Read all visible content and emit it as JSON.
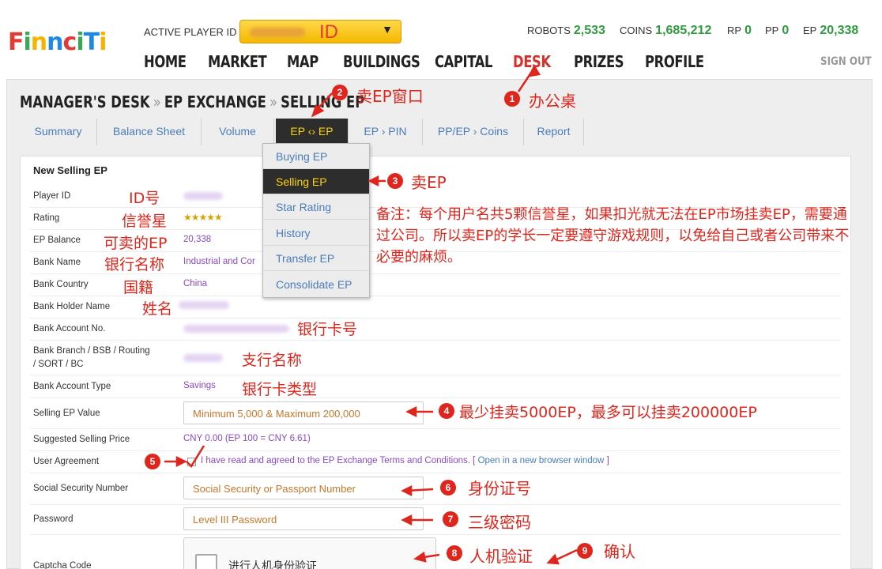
{
  "header": {
    "logo_letters": [
      "F",
      "i",
      "n",
      "n",
      "c",
      "i",
      "T",
      "i"
    ],
    "logo_colors": [
      "#e53935",
      "#3aa757",
      "#f4b400",
      "#1e88e5",
      "#e53935",
      "#3aa757",
      "#1e88e5",
      "#f4b400"
    ],
    "active_player_label": "ACTIVE PLAYER ID",
    "player_select_value": "ID",
    "stats": [
      {
        "label": "ROBOTS",
        "value": "2,533"
      },
      {
        "label": "COINS",
        "value": "1,685,212"
      },
      {
        "label": "RP",
        "value": "0"
      },
      {
        "label": "PP",
        "value": "0"
      },
      {
        "label": "EP",
        "value": "20,338"
      }
    ],
    "nav": [
      "HOME",
      "MARKET",
      "MAP",
      "BUILDINGS",
      "CAPITAL",
      "DESK",
      "PRIZES",
      "PROFILE"
    ],
    "active_nav": "DESK",
    "sign_out": "SIGN OUT"
  },
  "breadcrumb": [
    "MANAGER'S DESK",
    "EP EXCHANGE",
    "SELLING EP"
  ],
  "breadcrumb_separator": "»",
  "tabs": [
    "Summary",
    "Balance Sheet",
    "Volume",
    "EP ‹› EP",
    "EP › PIN",
    "PP/EP › Coins",
    "Report"
  ],
  "active_tab": "EP ‹› EP",
  "dropdown": [
    "Buying EP",
    "Selling EP",
    "Star Rating",
    "History",
    "Transfer EP",
    "Consolidate EP"
  ],
  "active_dropdown": "Selling EP",
  "form": {
    "title": "New Selling EP",
    "labels": {
      "player_id": "Player ID",
      "rating": "Rating",
      "ep_balance": "EP Balance",
      "bank_name": "Bank Name",
      "bank_country": "Bank Country",
      "bank_holder": "Bank Holder Name",
      "bank_account_no": "Bank Account No.",
      "bank_branch_1": "Bank Branch / BSB / Routing",
      "bank_branch_2": "/ SORT / BC",
      "bank_account_type": "Bank Account Type",
      "selling_ep_value": "Selling EP Value",
      "suggested_price": "Suggested Selling Price",
      "user_agreement": "User Agreement",
      "ssn": "Social Security Number",
      "password": "Password",
      "captcha": "Captcha Code"
    },
    "values": {
      "rating_stars": "★★★★★",
      "ep_balance": "20,338",
      "bank_name": "Industrial and Cor",
      "bank_country": "China",
      "bank_account_type": "Savings",
      "suggested_price": "CNY 0.00  (EP 100 = CNY 6.61)"
    },
    "placeholders": {
      "selling_ep_value": "Minimum 5,000 & Maximum 200,000",
      "ssn": "Social Security or Passport Number",
      "password": "Level III Password"
    },
    "agreement_text": "I have read and agreed to the EP Exchange Terms and Conditions. [",
    "agreement_link": "Open in a new browser window",
    "agreement_end": "]",
    "captcha_text": "进行人机身份验证"
  },
  "annotations": {
    "desk": "办公桌",
    "sell_window": "卖EP窗口",
    "sell_ep": "卖EP",
    "id_no": "ID号",
    "rating": "信誉星",
    "sellable_ep": "可卖的EP",
    "bank_name": "银行名称",
    "nationality": "国籍",
    "name": "姓名",
    "card_no": "银行卡号",
    "branch_name": "支行名称",
    "card_type": "银行卡类型",
    "min_max": "最少挂卖5000EP，最多可以挂卖200000EP",
    "id_number": "身份证号",
    "level3_pw": "三级密码",
    "captcha": "人机验证",
    "confirm": "确认",
    "note": "备注：每个用户名共5颗信誉星，如果扣光就无法在EP市场挂卖EP，需要通过公司。所以卖EP的学长一定要遵守游戏规则，以免给自己或者公司带来不必要的麻烦。"
  },
  "colors": {
    "accent_red": "#e0251c",
    "stat_green": "#2e9b3e",
    "tab_blue": "#4a7cb8",
    "active_yellow": "#ffd400"
  }
}
